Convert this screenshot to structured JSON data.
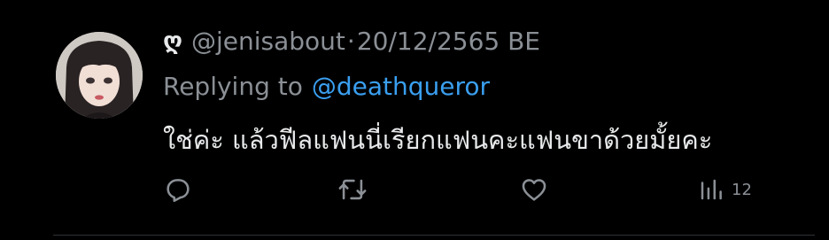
{
  "tweet": {
    "display_name": "ღ",
    "handle": "@jenisabout",
    "separator": "·",
    "date": "20/12/2565 BE",
    "replying_to_label": "Replying to",
    "replying_to_handle": "@deathqueror",
    "text": "ใช่ค่ะ แล้วฟีลแฟนนี่เรียกแฟนคะแฟนขาด้วยมั้ยคะ"
  },
  "actions": {
    "reply_icon": "reply-icon",
    "retweet_icon": "retweet-icon",
    "like_icon": "heart-icon",
    "views_icon": "views-icon",
    "views_count": "12"
  },
  "colors": {
    "background": "#000000",
    "primary_text": "#e7e9ea",
    "secondary_text": "#8b9096",
    "link": "#3a9ff0",
    "divider": "#2f3336"
  }
}
